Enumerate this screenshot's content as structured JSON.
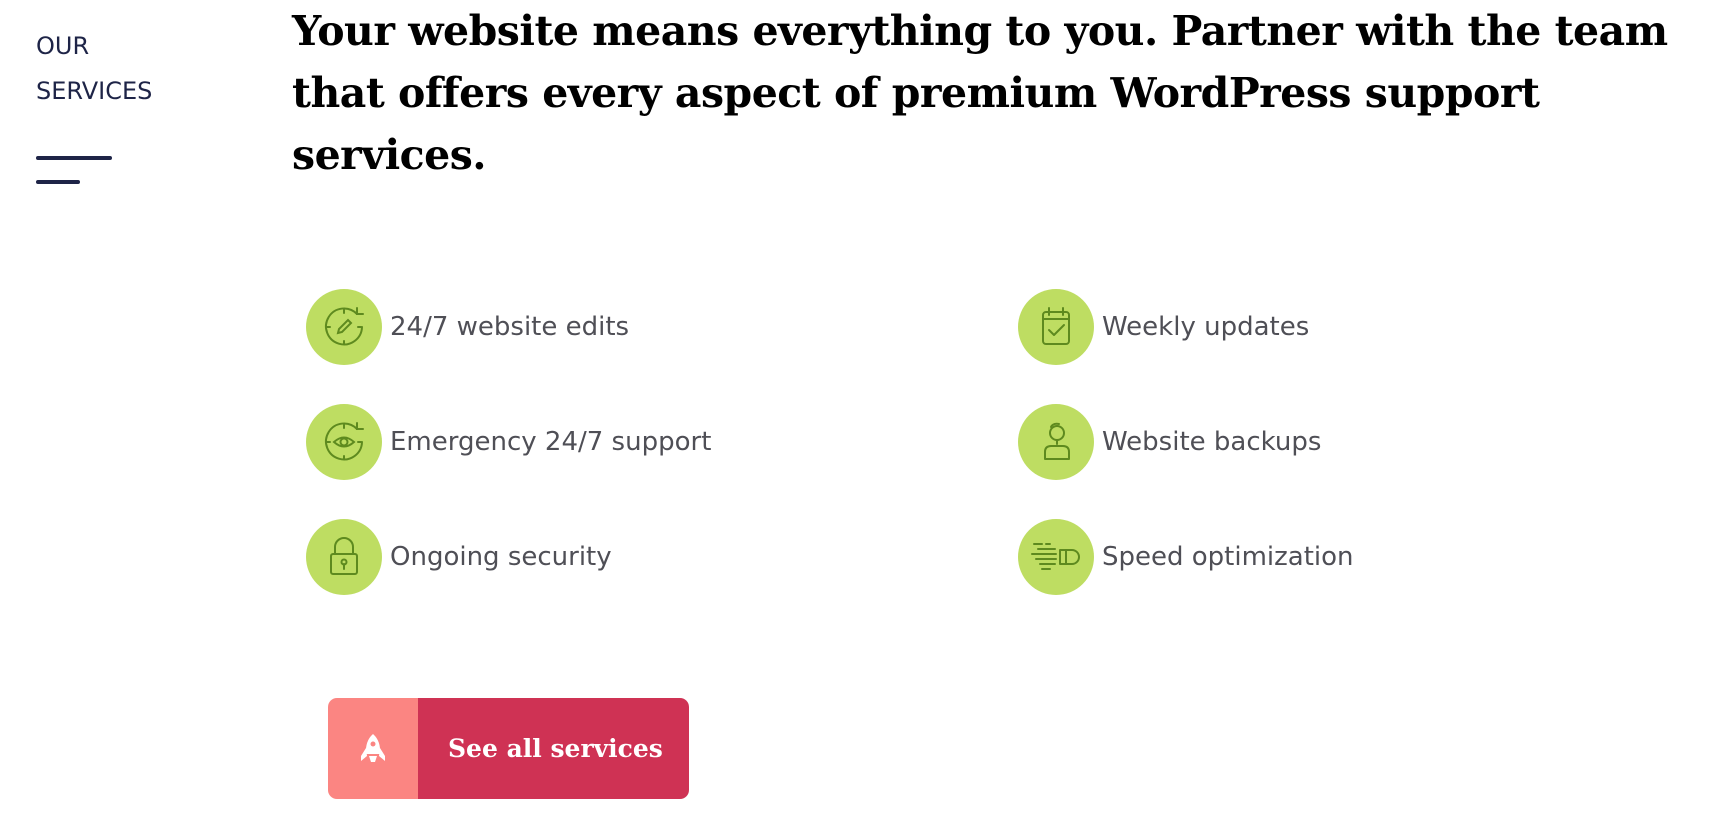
{
  "section_label": {
    "line1": "OUR",
    "line2": "SERVICES"
  },
  "headline": "Your website means everything to you. Partner with the team that offers every aspect of premium WordPress support services.",
  "services": [
    {
      "label": "24/7 website edits",
      "icon": "clock-pencil-icon"
    },
    {
      "label": "Weekly updates",
      "icon": "calendar-check-icon"
    },
    {
      "label": "Emergency 24/7 support",
      "icon": "clock-eye-icon"
    },
    {
      "label": "Website backups",
      "icon": "person-icon"
    },
    {
      "label": "Ongoing security",
      "icon": "padlock-icon"
    },
    {
      "label": "Speed optimization",
      "icon": "speed-bullet-icon"
    }
  ],
  "cta": {
    "label": "See all services",
    "icon": "rocket-icon"
  },
  "colors": {
    "navy": "#1e2447",
    "icon_bg": "#bedd62",
    "icon_stroke": "#5e8a1f",
    "service_text": "#4f4f56",
    "cta_icon_bg": "#fb8582",
    "cta_bg": "#cf3254"
  }
}
